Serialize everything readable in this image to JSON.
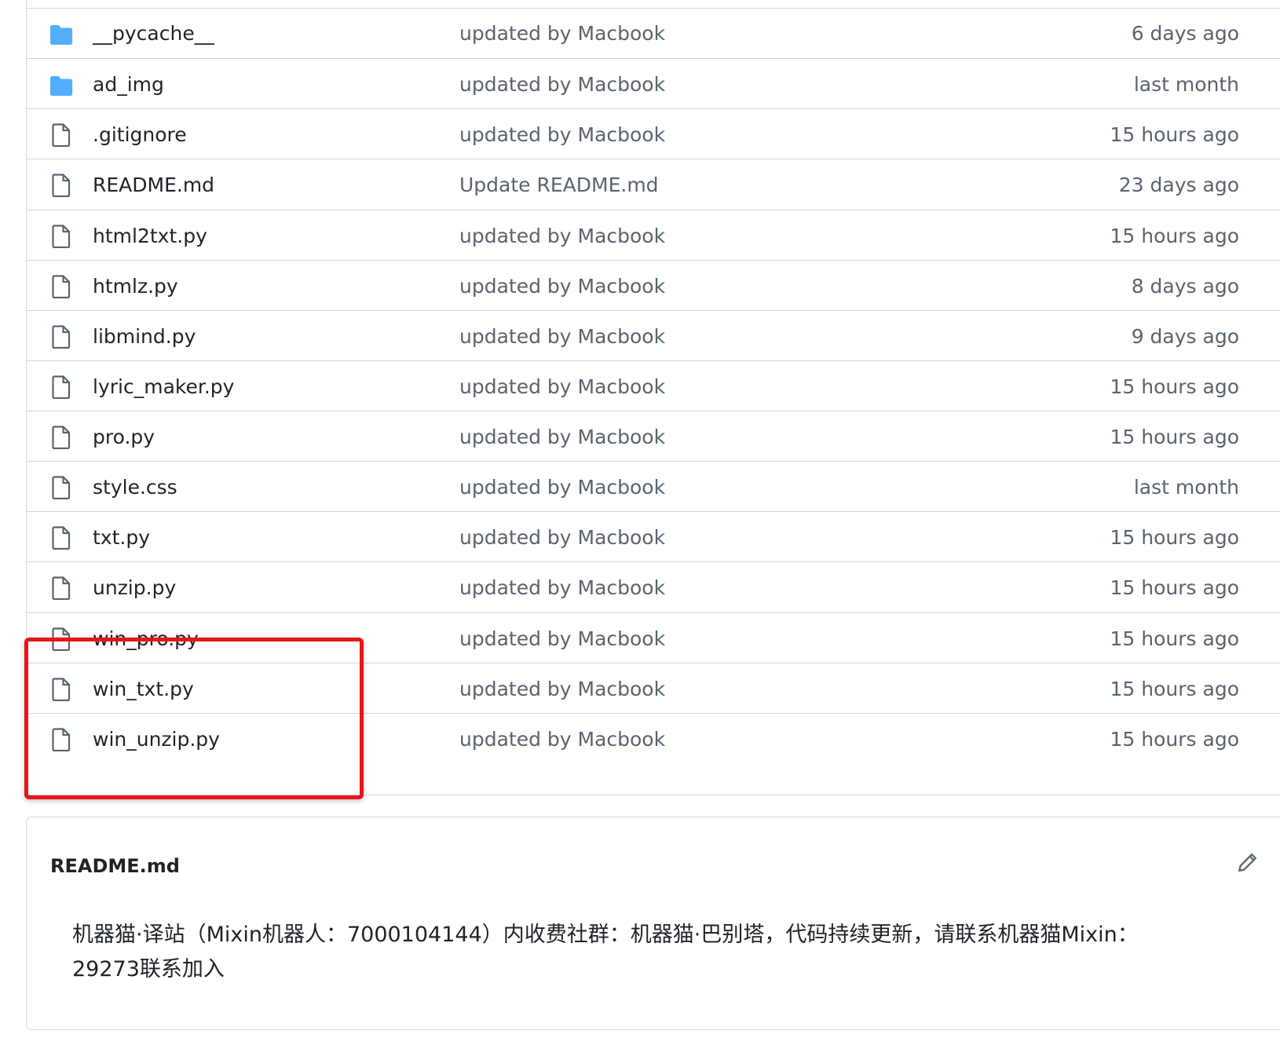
{
  "files": [
    {
      "type": "folder",
      "icon": "folder-icon",
      "name": "__pycache__",
      "commit": "updated by Macbook",
      "age": "6 days ago"
    },
    {
      "type": "folder",
      "icon": "folder-icon",
      "name": "ad_img",
      "commit": "updated by Macbook",
      "age": "last month"
    },
    {
      "type": "file",
      "icon": "file-icon",
      "name": ".gitignore",
      "commit": "updated by Macbook",
      "age": "15 hours ago"
    },
    {
      "type": "file",
      "icon": "file-icon",
      "name": "README.md",
      "commit": "Update README.md",
      "age": "23 days ago"
    },
    {
      "type": "file",
      "icon": "file-icon",
      "name": "html2txt.py",
      "commit": "updated by Macbook",
      "age": "15 hours ago"
    },
    {
      "type": "file",
      "icon": "file-icon",
      "name": "htmlz.py",
      "commit": "updated by Macbook",
      "age": "8 days ago"
    },
    {
      "type": "file",
      "icon": "file-icon",
      "name": "libmind.py",
      "commit": "updated by Macbook",
      "age": "9 days ago"
    },
    {
      "type": "file",
      "icon": "file-icon",
      "name": "lyric_maker.py",
      "commit": "updated by Macbook",
      "age": "15 hours ago"
    },
    {
      "type": "file",
      "icon": "file-icon",
      "name": "pro.py",
      "commit": "updated by Macbook",
      "age": "15 hours ago"
    },
    {
      "type": "file",
      "icon": "file-icon",
      "name": "style.css",
      "commit": "updated by Macbook",
      "age": "last month"
    },
    {
      "type": "file",
      "icon": "file-icon",
      "name": "txt.py",
      "commit": "updated by Macbook",
      "age": "15 hours ago"
    },
    {
      "type": "file",
      "icon": "file-icon",
      "name": "unzip.py",
      "commit": "updated by Macbook",
      "age": "15 hours ago"
    },
    {
      "type": "file",
      "icon": "file-icon",
      "name": "win_pro.py",
      "commit": "updated by Macbook",
      "age": "15 hours ago"
    },
    {
      "type": "file",
      "icon": "file-icon",
      "name": "win_txt.py",
      "commit": "updated by Macbook",
      "age": "15 hours ago"
    },
    {
      "type": "file",
      "icon": "file-icon",
      "name": "win_unzip.py",
      "commit": "updated by Macbook",
      "age": "15 hours ago"
    }
  ],
  "readme": {
    "title": "README.md",
    "edit_icon": "pencil-icon",
    "text": "机器猫·译站（Mixin机器人：7000104144）内收费社群：机器猫·巴别塔，代码持续更新，请联系机器猫Mixin：29273联系加入"
  },
  "colors": {
    "folder": "#54aeff",
    "file_icon": "#59636e",
    "border": "#d0d7de",
    "highlight": "#e8151b",
    "muted_text": "#59636e"
  }
}
